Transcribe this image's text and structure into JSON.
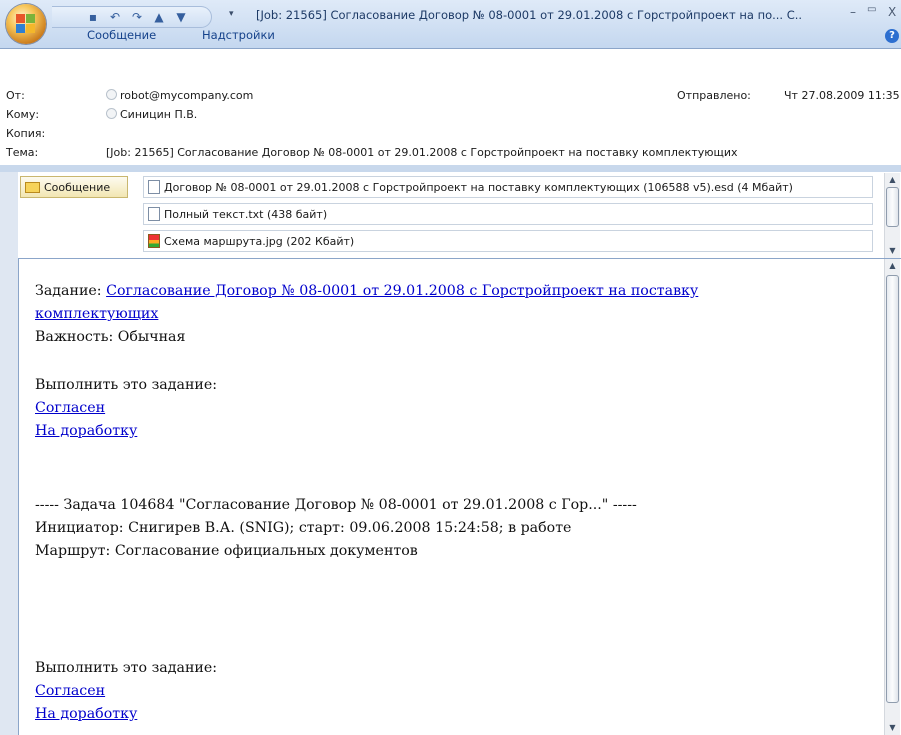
{
  "window": {
    "title": "[Job: 21565] Согласование Договор № 08-0001 от 29.01.2008 с Горстройпроект на по... С..",
    "minimize_glyph": "–",
    "restore_glyph": "▭",
    "close_glyph": "X"
  },
  "ribbon": {
    "tab_message": "Сообщение",
    "tab_addins": "Надстройки",
    "help_glyph": "?"
  },
  "header": {
    "from_label": "От:",
    "from_value": "robot@mycompany.com",
    "to_label": "Кому:",
    "to_value": "Синицин П.В.",
    "cc_label": "Копия:",
    "subject_label": "Тема:",
    "subject_value": "[Job: 21565] Согласование Договор № 08-0001 от 29.01.2008 с Горстройпроект на поставку комплектующих",
    "sent_label": "Отправлено:",
    "sent_value": "Чт 27.08.2009 11:35"
  },
  "attachments": {
    "message_tab": "Сообщение",
    "items": [
      {
        "label": "Договор № 08-0001 от 29.01.2008 с Горстройпроект на поставку комплектующих (106588 v5).esd (4 Мбайт)"
      },
      {
        "label": "Полный текст.txt (438 байт)"
      },
      {
        "label": "Схема маршрута.jpg (202 Кбайт)"
      }
    ]
  },
  "body": {
    "task_prefix": "Задание: ",
    "task_link_line1": "Согласование Договор № 08-0001 от 29.01.2008 с Горстройпроект на поставку",
    "task_link_line2": "комплектующих",
    "importance": "Важность: Обычная",
    "do_task_1": "Выполнить это задание:",
    "agree_1": "Согласен",
    "rework_1": "На доработку",
    "task_header": "----- Задача 104684 \"Согласование Договор № 08-0001 от 29.01.2008 с Гор...\" -----",
    "initiator": "Инициатор: Снигирев В.А. (SNIG); старт: 09.06.2008 15:24:58; в работе",
    "route": "Маршрут: Согласование официальных документов",
    "do_task_2": "Выполнить это задание:",
    "agree_2": "Согласен",
    "rework_2": "На доработку"
  },
  "icons": {
    "save": "save-icon",
    "undo": "undo-icon",
    "redo": "redo-icon",
    "prev": "arrow-up-icon",
    "next": "arrow-down-icon",
    "customize": "dropdown-icon"
  }
}
